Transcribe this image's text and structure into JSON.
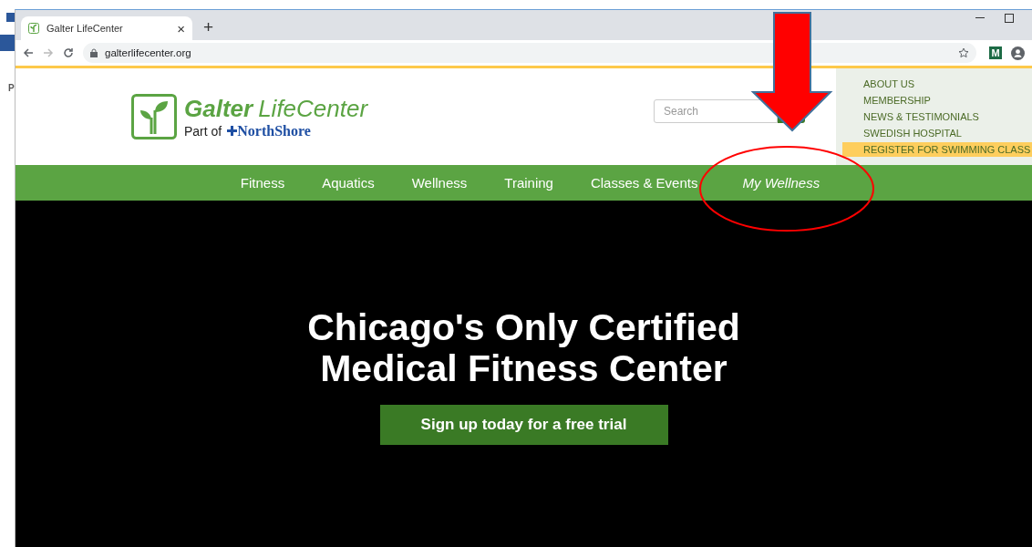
{
  "background_window": {
    "letter": "P"
  },
  "browser": {
    "tab_title": "Galter LifeCenter",
    "tab_close": "×",
    "new_tab": "+",
    "url": "galterlifecenter.org",
    "extension_label": "M"
  },
  "site": {
    "logo_title_bold": "Galter",
    "logo_title_rest": "LifeCenter",
    "logo_tagline": "Part of",
    "logo_partner": "NorthShore",
    "search": {
      "placeholder": "Search"
    },
    "utility_links": [
      {
        "label": "ABOUT US",
        "highlighted": false
      },
      {
        "label": "MEMBERSHIP",
        "highlighted": false
      },
      {
        "label": "NEWS & TESTIMONIALS",
        "highlighted": false
      },
      {
        "label": "SWEDISH HOSPITAL",
        "highlighted": false
      },
      {
        "label": "REGISTER FOR SWIMMING CLASS",
        "highlighted": true
      }
    ],
    "nav": [
      {
        "label": "Fitness",
        "kind": "link"
      },
      {
        "label": "Aquatics",
        "kind": "link"
      },
      {
        "label": "Wellness",
        "kind": "link"
      },
      {
        "label": "Training",
        "kind": "link"
      },
      {
        "label": "Classes & Events",
        "kind": "link"
      },
      {
        "label": "My Wellness",
        "kind": "featured"
      }
    ]
  },
  "hero": {
    "headline": "Chicago's Only Certified Medical Fitness Center",
    "cta": "Sign up today for a free trial"
  },
  "annotations": {
    "arrow": true,
    "ellipse": true
  }
}
